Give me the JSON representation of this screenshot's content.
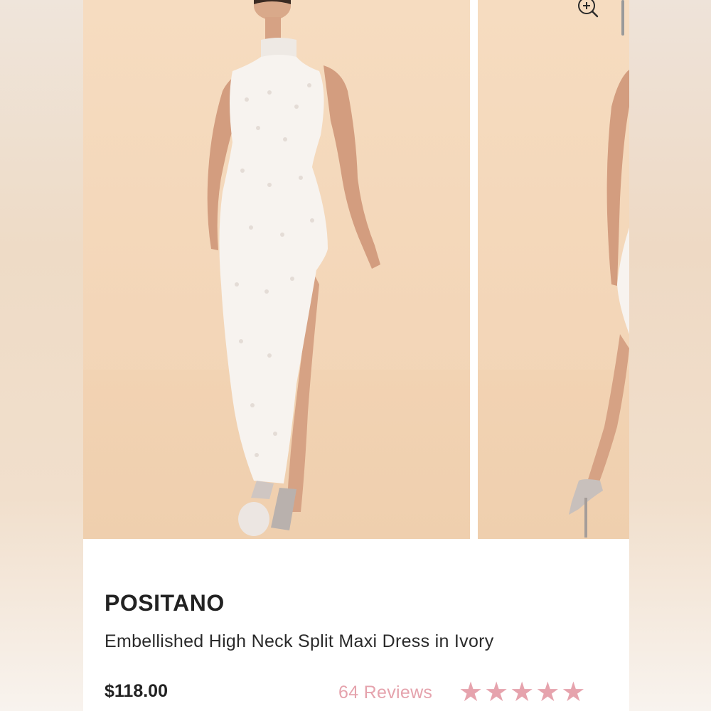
{
  "product": {
    "brand": "POSITANO",
    "name": "Embellished High Neck Split Maxi Dress in Ivory",
    "price": "$118.00",
    "reviews_label": "64 Reviews",
    "rating": 5,
    "rating_max": 5
  },
  "gallery": {
    "zoom_icon": "zoom-in-icon",
    "images": [
      "model-front-photo",
      "model-side-photo"
    ]
  },
  "colors": {
    "accent_pink": "#e6a3ad",
    "text_dark": "#222222",
    "photo_background": "#f4d9bd"
  }
}
